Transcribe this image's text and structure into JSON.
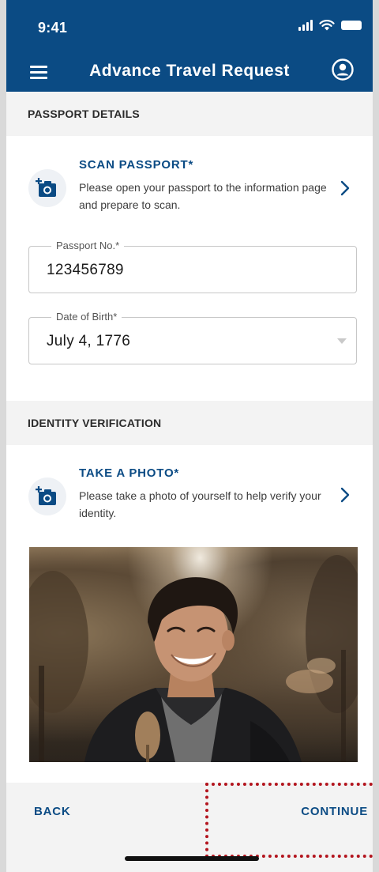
{
  "status_bar": {
    "time": "9:41"
  },
  "header": {
    "title": "Advance Travel Request"
  },
  "passport_section": {
    "heading": "PASSPORT DETAILS",
    "scan": {
      "title": "SCAN PASSPORT*",
      "description": "Please open your passport to the information page and prepare to scan."
    },
    "passport_no": {
      "label": "Passport No.*",
      "value": "123456789"
    },
    "date_of_birth": {
      "label": "Date of Birth*",
      "value": "July 4, 1776"
    }
  },
  "identity_section": {
    "heading": "IDENTITY VERIFICATION",
    "photo": {
      "title": "TAKE A PHOTO*",
      "description": "Please take a photo of yourself to help verify your identity."
    }
  },
  "footer": {
    "back_label": "BACK",
    "continue_label": "CONTINUE"
  },
  "colors": {
    "primary": "#0b4b84",
    "section_background": "#f3f3f3",
    "highlight": "#b3151e"
  },
  "icons": [
    "menu-icon",
    "profile-icon",
    "camera-add-icon",
    "chevron-right-icon",
    "dropdown-arrow-icon"
  ]
}
